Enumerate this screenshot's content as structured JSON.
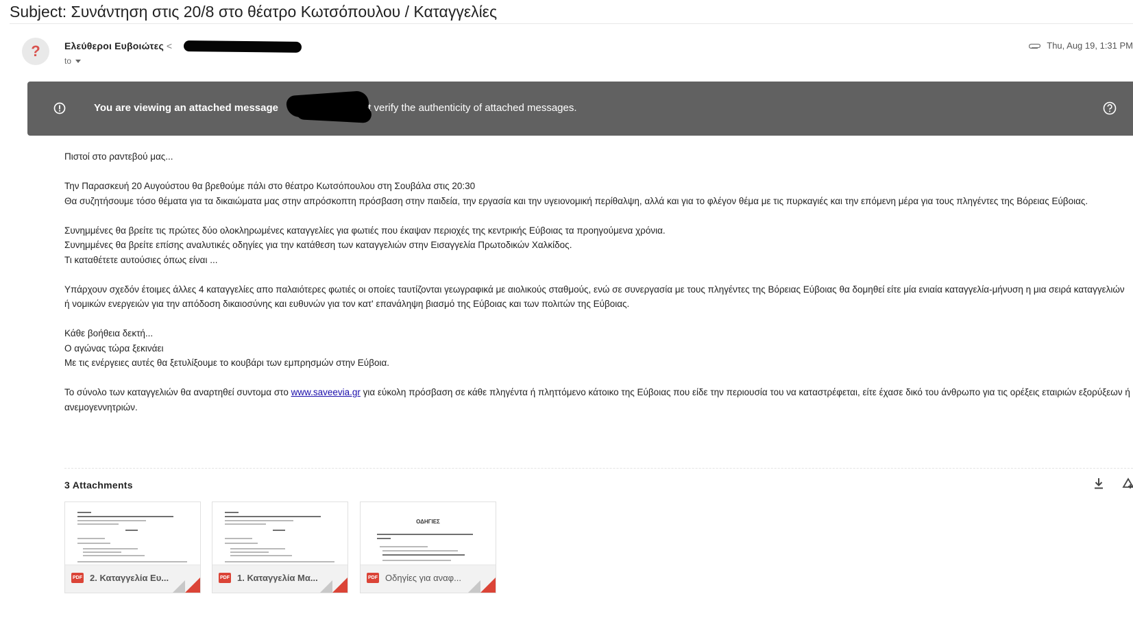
{
  "subject": "Subject: Συνάντηση στις 20/8 στο θέατρο Κωτσόπουλου / Καταγγελίες",
  "sender": {
    "avatar": "?",
    "name": "Ελεύθεροι Ευβοιώτες",
    "email_prefix": "<",
    "to_label": "to"
  },
  "header": {
    "date": "Thu, Aug 19, 1:31 PM",
    "attachment_icon": "paperclip-icon"
  },
  "banner": {
    "text_bold": "You are viewing an attached message",
    "text_rest": "n't verify the authenticity of attached messages.",
    "info_icon": "info-icon",
    "help_icon": "help-icon",
    "bg": "#616161"
  },
  "body": {
    "p1": "Πιστοί στο ραντεβού μας...",
    "p2_l1": "Την Παρασκευή 20 Αυγούστου θα βρεθούμε πάλι στο θέατρο Κωτσόπουλου στη Σουβάλα στις 20:30",
    "p2_l2": "Θα συζητήσουμε τόσο θέματα για τα δικαιώματα μας στην απρόσκοπτη πρόσβαση στην παιδεία, την εργασία και την υγειονομική περίθαλψη, αλλά και για το φλέγον θέμα με τις πυρκαγιές και την επόμενη μέρα για τους πληγέντες της Βόρειας Εύβοιας.",
    "p3_l1": "Συνημμένες θα βρείτε τις πρώτες δύο ολοκληρωμένες καταγγελίες για φωτιές που έκαψαν περιοχές της κεντρικής Εύβοιας τα προηγούμενα χρόνια.",
    "p3_l2": "Συνημμένες θα βρείτε επίσης αναλυτικές οδηγίες για την κατάθεση των καταγγελιών στην Εισαγγελία Πρωτοδικών Χαλκίδος.",
    "p3_l3": "Τι καταθέτετε αυτούσιες όπως είναι ...",
    "p4": "Υπάρχουν σχεδόν έτοιμες άλλες 4 καταγγελίες απο παλαιότερες φωτιές οι οποίες ταυτίζονται γεωγραφικά με αιολικούς σταθμούς, ενώ σε συνεργασία με τους πληγέντες της Βόρειας Εύβοιας θα δομηθεί είτε μία ενιαία καταγγελία-μήνυση η μια σειρά καταγγελιών ή νομικών ενεργειών για την απόδοση δικαιοσύνης και ευθυνών για τον κατ' επανάληψη βιασμό της Εύβοιας και των πολιτών της Εύβοιας.",
    "p5_l1": "Κάθε βοήθεια δεκτή...",
    "p5_l2": "Ο αγώνας τώρα ξεκινάει",
    "p5_l3": "Με τις ενέργειες αυτές θα ξετυλίξουμε το κουβάρι των εμπρησμών στην Εύβοια.",
    "p6_before": "Το σύνολο των καταγγελιών θα αναρτηθεί συντομα στο ",
    "p6_link": "www.saveevia.gr",
    "p6_after": " για εύκολη πρόσβαση σε κάθε πληγέντα ή πληττόμενο κάτοικο της Εύβοιας που είδε την περιουσία του να καταστρέφεται, είτε έχασε δικό του άνθρωπο για τις ορέξεις εταιριών εξορύξεων ή ανεμογεννητριών."
  },
  "attachments": {
    "heading": "3 Attachments",
    "download_icon": "download-icon",
    "drive_icon": "add-to-drive-icon",
    "items": [
      {
        "name": "2. Καταγγελία Ευ...",
        "type": "PDF"
      },
      {
        "name": "1. Καταγγελία Μα...",
        "type": "PDF"
      },
      {
        "name": "Οδηγίες για αναφ...",
        "type": "PDF",
        "preview_title": "ΟΔΗΓΙΕΣ"
      }
    ]
  }
}
